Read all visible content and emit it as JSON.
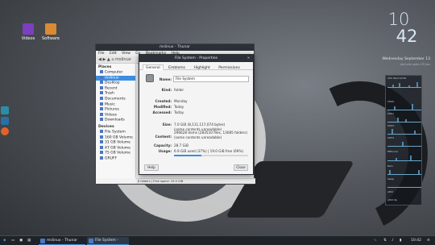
{
  "desktop": {
    "icons": [
      {
        "label": "Videos",
        "icon": "videos-folder-icon",
        "color": "#7b3fbf"
      },
      {
        "label": "Software",
        "icon": "software-package-icon",
        "color": "#d98a32"
      }
    ],
    "left_panel": [
      {
        "icon": "app-icon-1",
        "color": "#2a8fa6"
      },
      {
        "icon": "app-icon-2",
        "color": "#2a6fa6"
      },
      {
        "icon": "firefox-icon",
        "color": "#e2632a"
      }
    ]
  },
  "clock": {
    "hour": "10",
    "minute": "42"
  },
  "date": {
    "weekday": "Wednesday",
    "month_day": "September 13"
  },
  "timezones": "Add site stats  LTC/ms",
  "monitor": {
    "rows": [
      "CPU  Wed 10:56",
      "",
      "CPU0",
      "CPU1",
      "CPU2",
      "CPU3",
      "Fifthcore",
      "Ram",
      "Swap",
      "eth0",
      "eth0 Up"
    ]
  },
  "thunar": {
    "title": "mslinux - Thunar",
    "menu": [
      "File",
      "Edit",
      "View",
      "Go",
      "Bookmarks",
      "Help"
    ],
    "location": "mslinux",
    "sidebar": {
      "places_header": "Places",
      "places": [
        "Computer",
        "mslinux",
        "Desktop",
        "Recent",
        "Trash",
        "Documents",
        "Music",
        "Pictures",
        "Videos",
        "Downloads"
      ],
      "devices_header": "Devices",
      "devices": [
        "File System",
        "160 GB Volume",
        "31 GB Volume",
        "47 GB Volume",
        "75 GB Volume",
        "GRUFF"
      ]
    },
    "status": "8 folders  |  Free space: 19.0 GiB"
  },
  "properties": {
    "title": "File System - Properties",
    "tabs": [
      "General",
      "Emblems",
      "Highlight",
      "Permissions"
    ],
    "name_label": "Name:",
    "name_value": "File System",
    "kind_label": "Kind:",
    "kind_value": "folder",
    "created_label": "Created:",
    "created_value": "Monday",
    "modified_label": "Modified:",
    "modified_value": "Today",
    "accessed_label": "Accessed:",
    "accessed_value": "Today",
    "size_label": "Size:",
    "size_value": "7.0 GiB (8,111,117,074 bytes)",
    "size_note": "(some contents unreadable)",
    "content_label": "Content:",
    "content_value": "296628 items (283510 files, 13085 folders)",
    "content_note": "(some contents unreadable)",
    "capacity_label": "Capacity:",
    "capacity_value": "28.7 GiB",
    "usage_label": "Usage:",
    "usage_value": "6.9 GiB used (37%)  |  19.0 GiB free (69%)",
    "usage_fraction": 0.37,
    "help_label": "Help",
    "close_label": "Close"
  },
  "taskbar": {
    "tasks": [
      "mslinux - Thunar",
      "File System - Prope..."
    ],
    "time": "10:42",
    "accent": "#3d8de0"
  }
}
